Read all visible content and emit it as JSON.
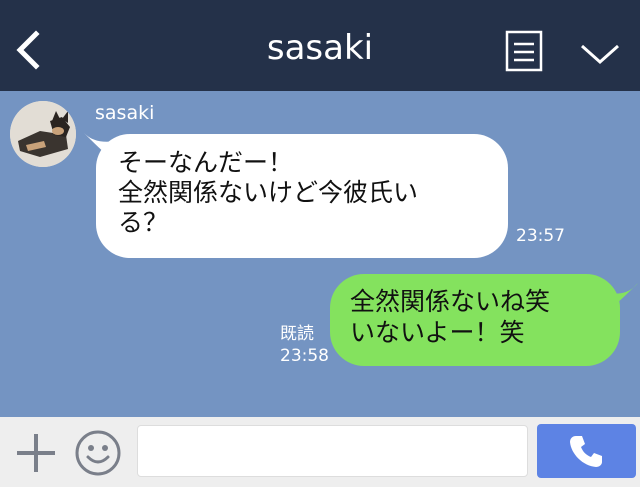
{
  "header": {
    "title": "sasaki",
    "back_icon": "chevron-left-icon",
    "menu_icon": "notes-icon",
    "collapse_icon": "chevron-down-icon"
  },
  "messages": [
    {
      "direction": "incoming",
      "sender": "sasaki",
      "lines": [
        "そーなんだー！",
        "全然関係ないけど今彼氏い",
        "る？"
      ],
      "time": "23:57"
    },
    {
      "direction": "outgoing",
      "lines": [
        "全然関係ないね笑",
        "いないよー！笑"
      ],
      "read_label": "既読",
      "time": "23:58"
    }
  ],
  "footer": {
    "input_value": "",
    "input_placeholder": "",
    "add_icon": "plus-icon",
    "sticker_icon": "smile-icon",
    "call_icon": "phone-icon"
  },
  "colors": {
    "header_bg": "#243149",
    "chat_bg": "#7494c2",
    "outgoing_bubble": "#84e25e",
    "incoming_bubble": "#ffffff",
    "call_button": "#5d83e4"
  }
}
